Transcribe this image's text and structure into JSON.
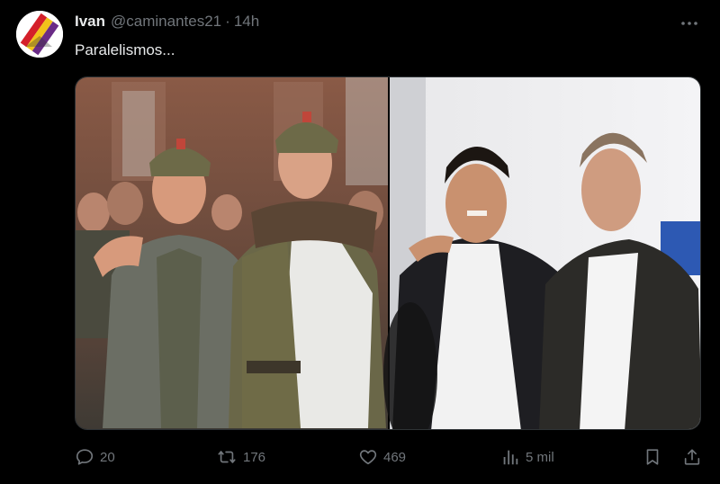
{
  "tweet": {
    "author_name": "Ivan",
    "author_handle": "@caminantes21",
    "separator": "·",
    "time": "14h",
    "text": "Paralelismos..."
  },
  "actions": {
    "replies": "20",
    "reposts": "176",
    "likes": "469",
    "views": "5 mil"
  },
  "icons": {
    "avatar": "republican-flag-avatar",
    "more": "more-dots-icon",
    "reply": "reply-bubble-icon",
    "repost": "repost-arrows-icon",
    "like": "heart-icon",
    "views": "bar-chart-icon",
    "bookmark": "bookmark-icon",
    "share": "share-upload-icon"
  },
  "colors": {
    "background": "#000000",
    "text_primary": "#e7e9ea",
    "text_secondary": "#71767b",
    "border": "#2f3336"
  }
}
